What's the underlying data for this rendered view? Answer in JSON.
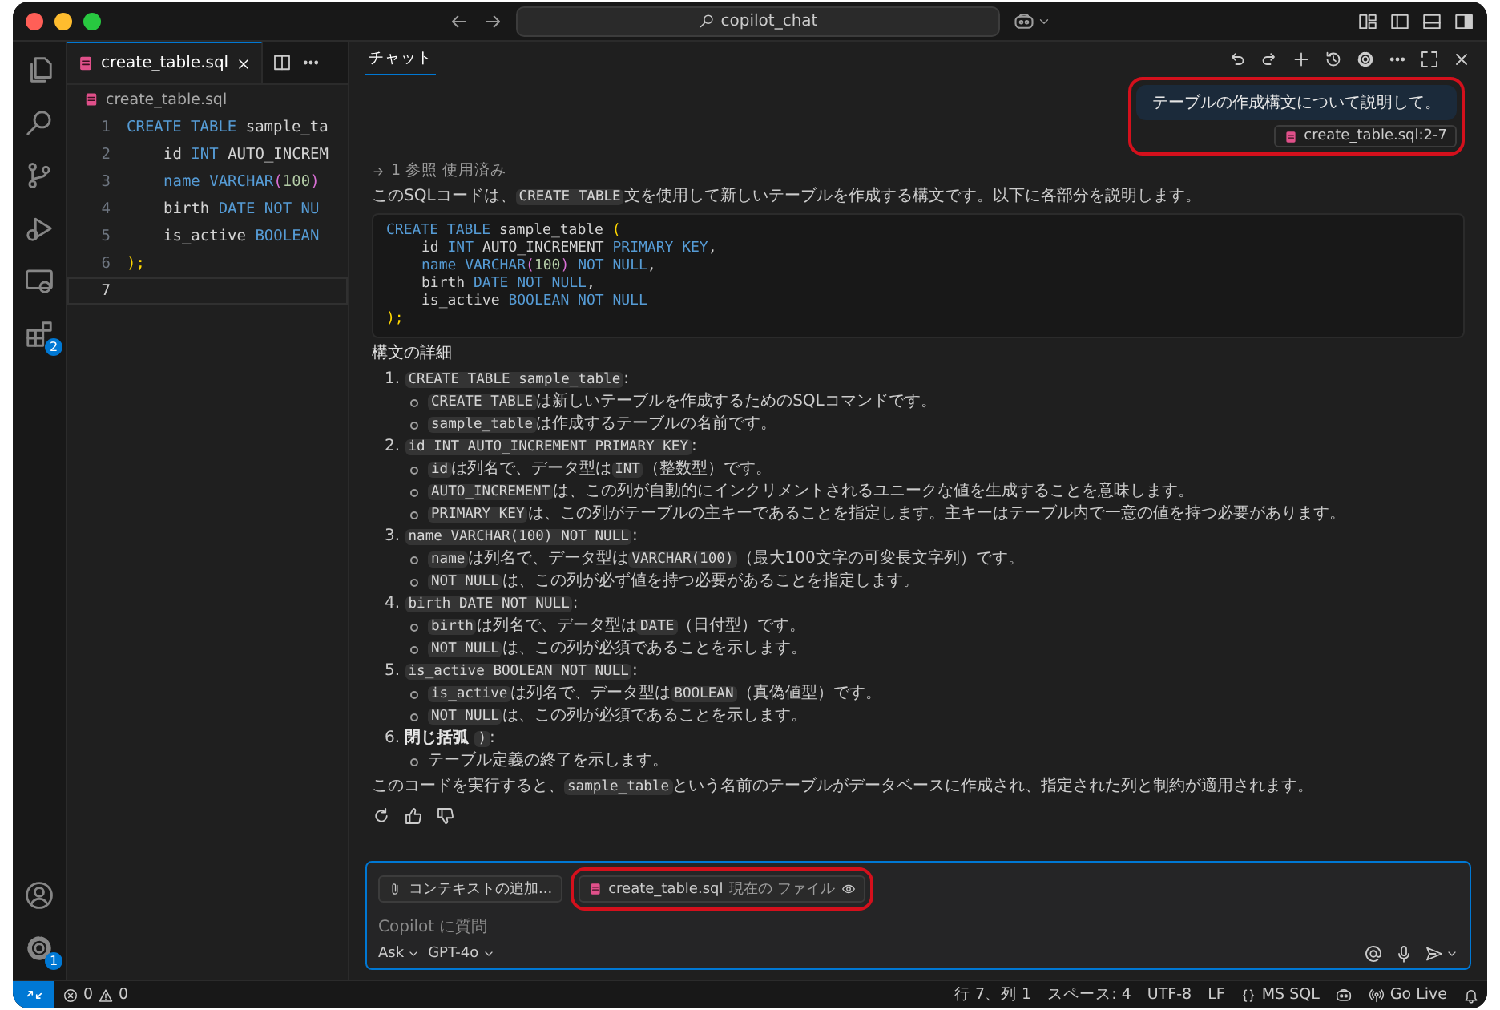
{
  "window": {
    "search": "copilot_chat"
  },
  "activity_bar": {
    "extensions_badge": "2",
    "settings_badge": "1"
  },
  "editor": {
    "tab": {
      "label": "create_table.sql",
      "selected": true
    },
    "breadcrumb": "create_table.sql",
    "lines": [
      {
        "number": "1",
        "current": false,
        "indented": false,
        "tokens": [
          {
            "text": "CREATE TABLE ",
            "kind": "keyword"
          },
          {
            "text": "sample_ta",
            "kind": "identifier"
          }
        ]
      },
      {
        "number": "2",
        "current": false,
        "indented": true,
        "tokens": [
          {
            "text": "id ",
            "kind": "identifier"
          },
          {
            "text": "INT ",
            "kind": "keyword"
          },
          {
            "text": "AUTO_INCREM",
            "kind": "identifier"
          }
        ]
      },
      {
        "number": "3",
        "current": false,
        "indented": true,
        "tokens": [
          {
            "text": "name ",
            "kind": "keyword"
          },
          {
            "text": "VARCHAR",
            "kind": "keyword"
          },
          {
            "text": "(",
            "kind": "bracket"
          },
          {
            "text": "100",
            "kind": "number"
          },
          {
            "text": ")",
            "kind": "bracket"
          }
        ]
      },
      {
        "number": "4",
        "current": false,
        "indented": true,
        "tokens": [
          {
            "text": "birth ",
            "kind": "identifier"
          },
          {
            "text": "DATE NOT NU",
            "kind": "keyword"
          }
        ]
      },
      {
        "number": "5",
        "current": false,
        "indented": true,
        "tokens": [
          {
            "text": "is_active ",
            "kind": "identifier"
          },
          {
            "text": "BOOLEAN",
            "kind": "keyword"
          }
        ]
      },
      {
        "number": "6",
        "current": false,
        "indented": false,
        "tokens": [
          {
            "text": ");",
            "kind": "paren"
          }
        ]
      },
      {
        "number": "7",
        "current": true
      }
    ]
  },
  "chat": {
    "tab": {
      "label": "チャット",
      "selected": true
    },
    "user_message": {
      "text": "テーブルの作成構文について説明して。",
      "reference": "create_table.sql:2-7",
      "highlighted": true
    },
    "references": "1 参照 使用済み",
    "intro": [
      {
        "text": "このSQLコードは、",
        "kind": "plain"
      },
      {
        "text": "CREATE TABLE",
        "kind": "code"
      },
      {
        "text": "文を使用して新しいテーブルを作成する構文です。以下に各部分を説明します。",
        "kind": "plain"
      }
    ],
    "code": [
      {
        "indented": false,
        "tokens": [
          {
            "text": "CREATE TABLE ",
            "kind": "keyword"
          },
          {
            "text": "sample_table ",
            "kind": "identifier"
          },
          {
            "text": "(",
            "kind": "paren"
          }
        ]
      },
      {
        "indented": true,
        "tokens": [
          {
            "text": "id ",
            "kind": "identifier"
          },
          {
            "text": "INT ",
            "kind": "keyword"
          },
          {
            "text": "AUTO_INCREMENT ",
            "kind": "identifier"
          },
          {
            "text": "PRIMARY KEY",
            "kind": "keyword"
          },
          {
            "text": ",",
            "kind": "identifier"
          }
        ]
      },
      {
        "indented": true,
        "tokens": [
          {
            "text": "name ",
            "kind": "keyword"
          },
          {
            "text": "VARCHAR",
            "kind": "keyword"
          },
          {
            "text": "(",
            "kind": "bracket"
          },
          {
            "text": "100",
            "kind": "number"
          },
          {
            "text": ") ",
            "kind": "bracket"
          },
          {
            "text": "NOT NULL",
            "kind": "keyword"
          },
          {
            "text": ",",
            "kind": "identifier"
          }
        ]
      },
      {
        "indented": true,
        "tokens": [
          {
            "text": "birth ",
            "kind": "identifier"
          },
          {
            "text": "DATE NOT NULL",
            "kind": "keyword"
          },
          {
            "text": ",",
            "kind": "identifier"
          }
        ]
      },
      {
        "indented": true,
        "tokens": [
          {
            "text": "is_active ",
            "kind": "identifier"
          },
          {
            "text": "BOOLEAN NOT NULL",
            "kind": "keyword"
          }
        ]
      },
      {
        "indented": false,
        "tokens": [
          {
            "text": ");",
            "kind": "paren"
          }
        ]
      }
    ],
    "heading": "構文の詳細",
    "items": [
      {
        "number": "1.",
        "title": [
          {
            "text": "CREATE TABLE sample_table",
            "kind": "code"
          },
          {
            "text": ":",
            "kind": "plain"
          }
        ],
        "bullets": [
          [
            {
              "text": "CREATE TABLE",
              "kind": "code"
            },
            {
              "text": "は新しいテーブルを作成するためのSQLコマンドです。",
              "kind": "plain"
            }
          ],
          [
            {
              "text": "sample_table",
              "kind": "code"
            },
            {
              "text": "は作成するテーブルの名前です。",
              "kind": "plain"
            }
          ]
        ]
      },
      {
        "number": "2.",
        "title": [
          {
            "text": "id INT AUTO_INCREMENT PRIMARY KEY",
            "kind": "code"
          },
          {
            "text": ":",
            "kind": "plain"
          }
        ],
        "bullets": [
          [
            {
              "text": "id",
              "kind": "code"
            },
            {
              "text": "は列名で、データ型は",
              "kind": "plain"
            },
            {
              "text": "INT",
              "kind": "code"
            },
            {
              "text": "（整数型）です。",
              "kind": "plain"
            }
          ],
          [
            {
              "text": "AUTO_INCREMENT",
              "kind": "code"
            },
            {
              "text": "は、この列が自動的にインクリメントされるユニークな値を生成することを意味します。",
              "kind": "plain"
            }
          ],
          [
            {
              "text": "PRIMARY KEY",
              "kind": "code"
            },
            {
              "text": "は、この列がテーブルの主キーであることを指定します。主キーはテーブル内で一意の値を持つ必要があります。",
              "kind": "plain"
            }
          ]
        ]
      },
      {
        "number": "3.",
        "title": [
          {
            "text": "name VARCHAR(100) NOT NULL",
            "kind": "code"
          },
          {
            "text": ":",
            "kind": "plain"
          }
        ],
        "bullets": [
          [
            {
              "text": "name",
              "kind": "code"
            },
            {
              "text": "は列名で、データ型は",
              "kind": "plain"
            },
            {
              "text": "VARCHAR(100)",
              "kind": "code"
            },
            {
              "text": "（最大100文字の可変長文字列）です。",
              "kind": "plain"
            }
          ],
          [
            {
              "text": "NOT NULL",
              "kind": "code"
            },
            {
              "text": "は、この列が必ず値を持つ必要があることを指定します。",
              "kind": "plain"
            }
          ]
        ]
      },
      {
        "number": "4.",
        "title": [
          {
            "text": "birth DATE NOT NULL",
            "kind": "code"
          },
          {
            "text": ":",
            "kind": "plain"
          }
        ],
        "bullets": [
          [
            {
              "text": "birth",
              "kind": "code"
            },
            {
              "text": "は列名で、データ型は",
              "kind": "plain"
            },
            {
              "text": "DATE",
              "kind": "code"
            },
            {
              "text": "（日付型）です。",
              "kind": "plain"
            }
          ],
          [
            {
              "text": "NOT NULL",
              "kind": "code"
            },
            {
              "text": "は、この列が必須であることを示します。",
              "kind": "plain"
            }
          ]
        ]
      },
      {
        "number": "5.",
        "title": [
          {
            "text": "is_active BOOLEAN NOT NULL",
            "kind": "code"
          },
          {
            "text": ":",
            "kind": "plain"
          }
        ],
        "bullets": [
          [
            {
              "text": "is_active",
              "kind": "code"
            },
            {
              "text": "は列名で、データ型は",
              "kind": "plain"
            },
            {
              "text": "BOOLEAN",
              "kind": "code"
            },
            {
              "text": "（真偽値型）です。",
              "kind": "plain"
            }
          ],
          [
            {
              "text": "NOT NULL",
              "kind": "code"
            },
            {
              "text": "は、この列が必須であることを示します。",
              "kind": "plain"
            }
          ]
        ]
      },
      {
        "number": "6.",
        "title": [
          {
            "text": "閉じ括弧 ",
            "kind": "strong"
          },
          {
            "text": ")",
            "kind": "code"
          },
          {
            "text": ":",
            "kind": "plain"
          }
        ],
        "bullets": [
          [
            {
              "text": "テーブル定義の終了を示します。",
              "kind": "plain"
            }
          ]
        ]
      }
    ],
    "conclusion": [
      {
        "text": "このコードを実行すると、",
        "kind": "plain"
      },
      {
        "text": "sample_table",
        "kind": "code"
      },
      {
        "text": "という名前のテーブルがデータベースに作成され、指定された列と制約が適用されます。",
        "kind": "plain"
      }
    ],
    "input": {
      "add_context": "コンテキストの追加...",
      "file_chip": {
        "name": "create_table.sql",
        "note": "現在の ファイル",
        "highlighted": true
      },
      "placeholder": "Copilot に質問",
      "mode": "Ask",
      "model": "GPT-4o"
    }
  },
  "status_bar": {
    "errors": "0",
    "warnings": "0",
    "position": "行 7、列 1",
    "spaces": "スペース: 4",
    "encoding": "UTF-8",
    "eol": "LF",
    "language": "MS SQL",
    "go_live": "Go Live"
  }
}
